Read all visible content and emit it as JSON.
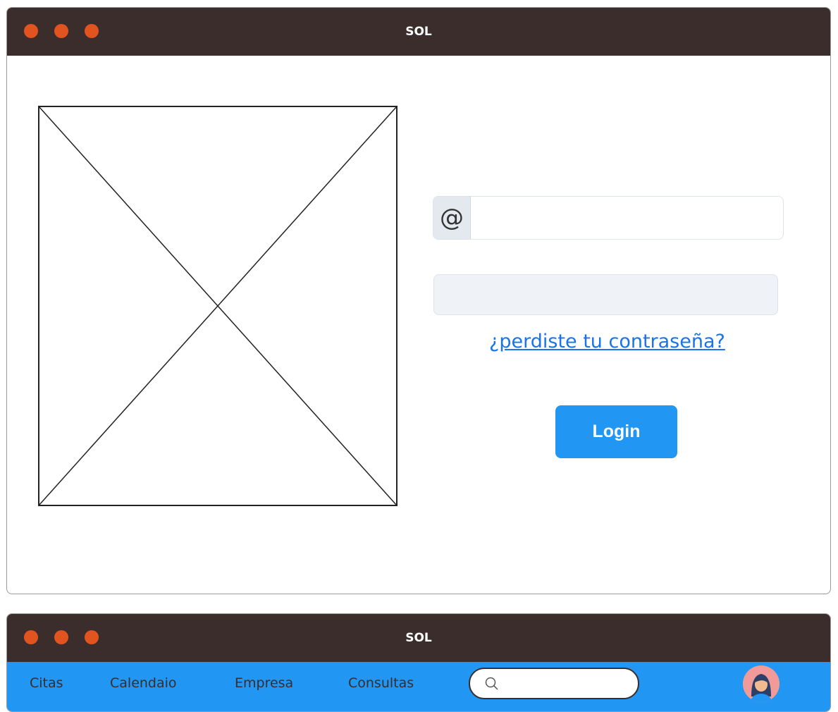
{
  "login_window": {
    "title": "SOL",
    "email_icon": "@",
    "email_value": "",
    "password_value": "",
    "forgot_password_link": "¿perdiste tu contraseña?",
    "login_button": "Login",
    "image_placeholder": "image-placeholder-icon"
  },
  "main_window": {
    "title": "SOL",
    "nav": {
      "items": [
        {
          "label": "Citas"
        },
        {
          "label": "Calendaio"
        },
        {
          "label": "Empresa"
        },
        {
          "label": "Consultas"
        }
      ]
    },
    "search": {
      "icon": "search-icon",
      "value": ""
    },
    "avatar_icon": "user-avatar-icon"
  },
  "colors": {
    "titlebar": "#3a2d2c",
    "window_control": "#e2541f",
    "accent": "#2196f3",
    "link": "#1a73e8",
    "password_field_bg": "#eff3f7",
    "avatar_bg": "#f19a9a"
  }
}
